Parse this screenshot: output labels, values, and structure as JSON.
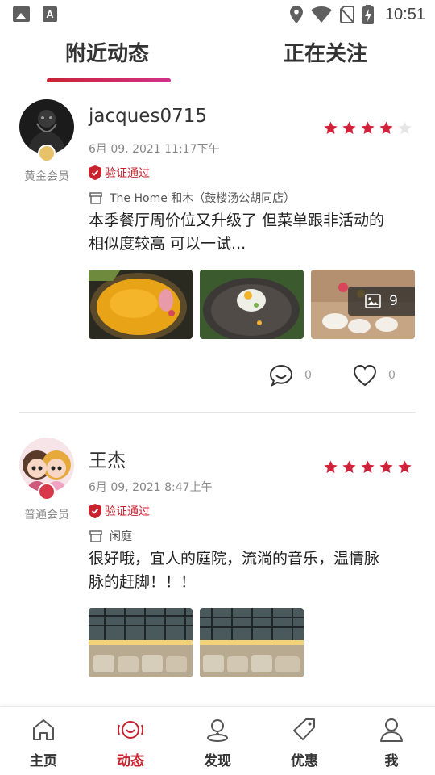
{
  "status_bar": {
    "time": "10:51",
    "icons": [
      "gallery-icon",
      "font-icon",
      "location-icon",
      "wifi-icon",
      "no-sim-icon",
      "battery-charging-icon"
    ]
  },
  "tabs": [
    {
      "label": "附近动态",
      "active": true
    },
    {
      "label": "正在关注",
      "active": false
    }
  ],
  "posts": [
    {
      "username": "jacques0715",
      "member_level": "黄金会员",
      "datetime": "6月 09, 2021  11:17下午",
      "verified_label": "验证通过",
      "place": "The Home 和木（鼓楼汤公胡同店）",
      "content_line1": "本季餐厅周价位又升级了 但菜单跟非活动的",
      "content_line2": "相似度较高 可以一试...",
      "rating": 4,
      "rating_max": 5,
      "image_count": "9",
      "comments": "0",
      "likes": "0"
    },
    {
      "username": "王杰",
      "member_level": "普通会员",
      "datetime": "6月 09, 2021  8:47上午",
      "verified_label": "验证通过",
      "place": "闲庭",
      "content_line1": "很好哦，宜人的庭院，流淌的音乐，温情脉",
      "content_line2": "脉的赶脚！！！",
      "rating": 5,
      "rating_max": 5
    }
  ],
  "bottom_nav": [
    {
      "label": "主页",
      "icon": "home-icon",
      "active": false
    },
    {
      "label": "动态",
      "icon": "feed-icon",
      "active": true
    },
    {
      "label": "发现",
      "icon": "discover-icon",
      "active": false
    },
    {
      "label": "优惠",
      "icon": "tag-icon",
      "active": false
    },
    {
      "label": "我",
      "icon": "profile-icon",
      "active": false
    }
  ],
  "colors": {
    "accent": "#c8222f",
    "star": "#d0223a",
    "star_empty": "#e6e6e6"
  }
}
